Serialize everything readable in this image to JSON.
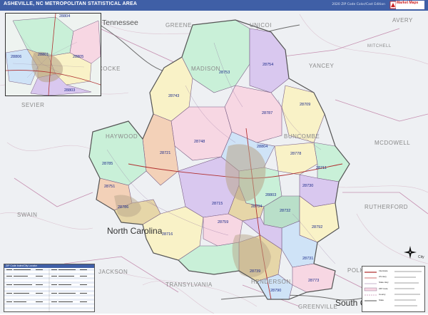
{
  "header": {
    "title": "ASHEVILLE, NC METROPOLITAN STATISTICAL AREA",
    "edition": "2020 ZIP Code Color/Cast Edition",
    "logo_text": "Market Maps"
  },
  "states": {
    "tennessee": "Tennessee",
    "north_carolina": "North Carolina",
    "south_carolina": "South C"
  },
  "counties": {
    "greene": "GREENE",
    "unicoi": "UNICOI",
    "avery": "AVERY",
    "mitchell": "MITCHELL",
    "yancey": "YANCEY",
    "cocke": "COCKE",
    "madison": "MADISON",
    "sevier": "SEVIER",
    "haywood": "HAYWOOD",
    "buncombe": "BUNCOMBE",
    "mcdowell": "MCDOWELL",
    "rutherford": "RUTHERFORD",
    "swain": "SWAIN",
    "jackson": "JACKSON",
    "transylvania": "TRANSYLVANIA",
    "henderson": "HENDERSON",
    "polk": "POLK",
    "greenville": "GREENVILLE"
  },
  "zips": {
    "z28753": "28753",
    "z28754": "28754",
    "z28743": "28743",
    "z28787": "28787",
    "z28709": "28709",
    "z28748": "28748",
    "z28804": "28804",
    "z28721": "28721",
    "z28778": "28778",
    "z28711": "28711",
    "z28785": "28785",
    "z28751": "28751",
    "z28786": "28786",
    "z28730": "28730",
    "z28803": "28803",
    "z28715": "28715",
    "z28704": "28704",
    "z28732": "28732",
    "z28716": "28716",
    "z28759": "28759",
    "z28792": "28792",
    "z28731": "28731",
    "z28739": "28739",
    "z28773": "28773",
    "z28790": "28790"
  },
  "inset": {
    "z28804": "28804",
    "z28806": "28806",
    "z28801": "28801",
    "z28805": "28805",
    "z28803": "28803"
  },
  "legend_table": {
    "title": "ZIP Code Index/City Locator"
  },
  "legend_box": {
    "compass_label": "City",
    "rows": [
      "Interstate",
      "US Hwy",
      "State Hwy",
      "ZIP Code",
      "County",
      "State"
    ]
  },
  "colors": {
    "header_bg": "#3f5fa6",
    "map_bg": "#e9ecef",
    "zip_label": "#1b2a8a",
    "county_label": "#8a8a8a",
    "zip_fills": [
      "#c9f0d8",
      "#d9c8ef",
      "#f7d7e3",
      "#f9f2c7",
      "#cfe3f7",
      "#f3d1b8",
      "#b9dfc9",
      "#e6d6a8"
    ]
  }
}
